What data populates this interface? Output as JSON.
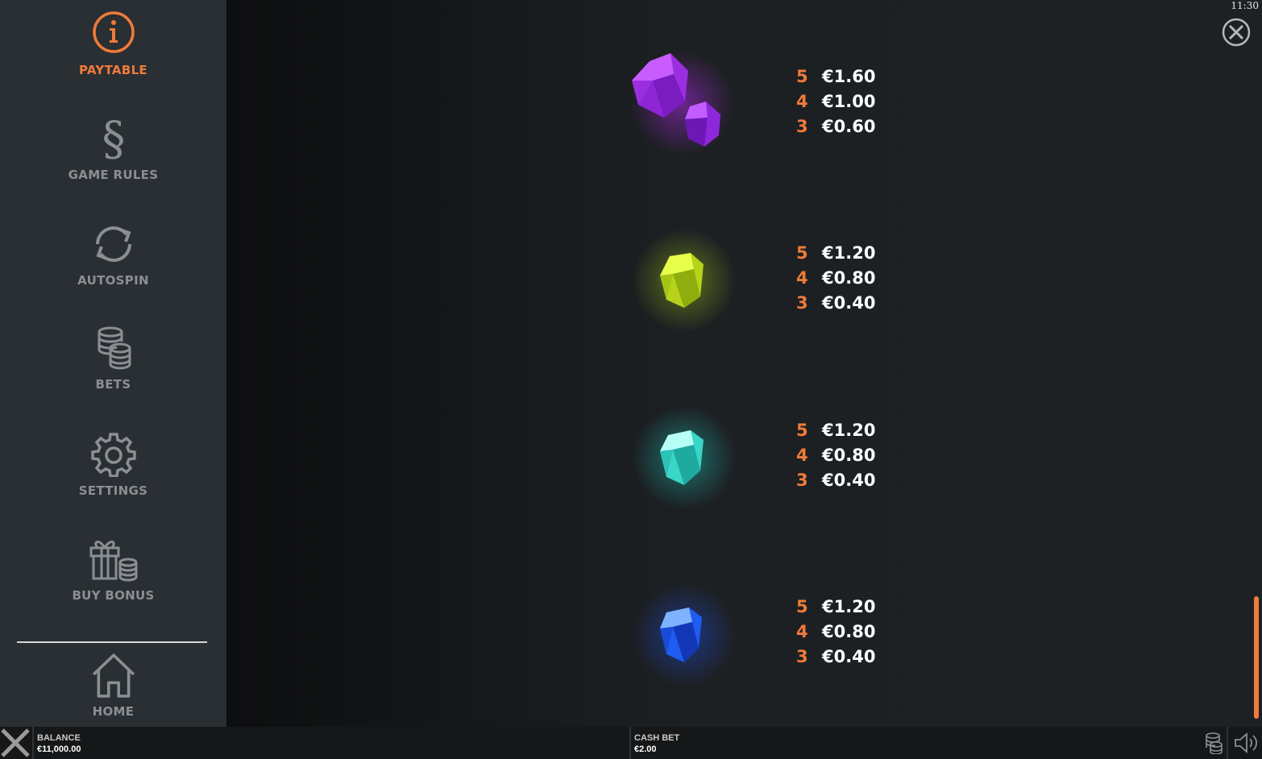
{
  "clock": "11:30",
  "colors": {
    "accent": "#ef7b3a",
    "sidebar_bg": "#2a2f33",
    "menu_inactive": "#8a8f93"
  },
  "sidebar": {
    "items": [
      {
        "label": "PAYTABLE",
        "icon": "info-icon",
        "active": true
      },
      {
        "label": "GAME RULES",
        "icon": "section-sign-icon",
        "active": false
      },
      {
        "label": "AUTOSPIN",
        "icon": "autospin-icon",
        "active": false
      },
      {
        "label": "BETS",
        "icon": "coins-stack-icon",
        "active": false
      },
      {
        "label": "SETTINGS",
        "icon": "gear-icon",
        "active": false
      },
      {
        "label": "BUY BONUS",
        "icon": "gift-coins-icon",
        "active": false
      },
      {
        "label": "HOME",
        "icon": "home-icon",
        "active": false
      }
    ]
  },
  "paytable": [
    {
      "symbol": "purple-gems",
      "payouts": [
        {
          "count": "5",
          "value": "€1.60"
        },
        {
          "count": "4",
          "value": "€1.00"
        },
        {
          "count": "3",
          "value": "€0.60"
        }
      ]
    },
    {
      "symbol": "yellow-green-gem",
      "payouts": [
        {
          "count": "5",
          "value": "€1.20"
        },
        {
          "count": "4",
          "value": "€0.80"
        },
        {
          "count": "3",
          "value": "€0.40"
        }
      ]
    },
    {
      "symbol": "cyan-gem",
      "payouts": [
        {
          "count": "5",
          "value": "€1.20"
        },
        {
          "count": "4",
          "value": "€0.80"
        },
        {
          "count": "3",
          "value": "€0.40"
        }
      ]
    },
    {
      "symbol": "blue-gem",
      "payouts": [
        {
          "count": "5",
          "value": "€1.20"
        },
        {
          "count": "4",
          "value": "€0.80"
        },
        {
          "count": "3",
          "value": "€0.40"
        }
      ]
    }
  ],
  "bottom_bar": {
    "balance_label": "BALANCE",
    "balance_value": "€11,000.00",
    "cash_bet_label": "CASH BET",
    "cash_bet_value": "€2.00"
  }
}
